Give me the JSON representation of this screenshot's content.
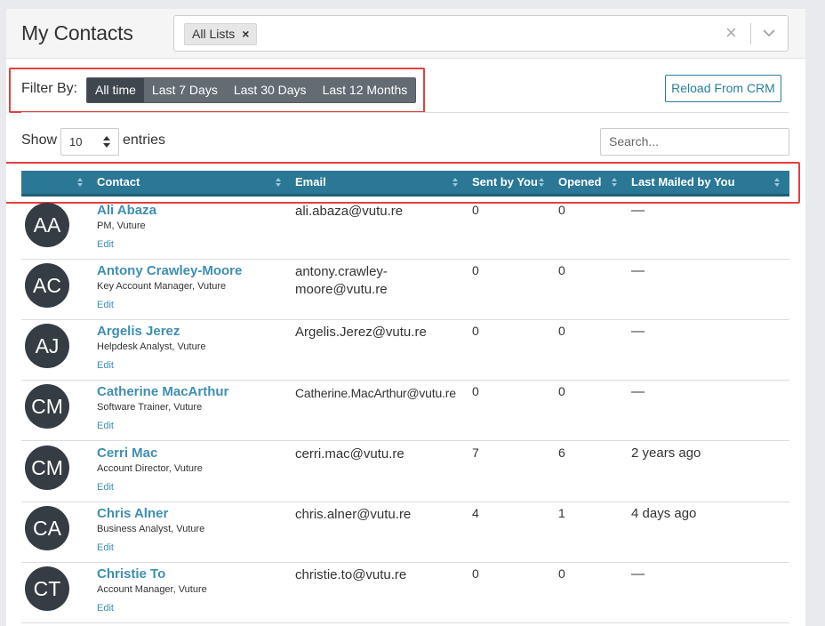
{
  "header": {
    "title": "My Contacts",
    "list_chip": "All Lists",
    "chip_remove": "×",
    "clear": "×"
  },
  "filter": {
    "label": "Filter By:",
    "options": [
      "All time",
      "Last 7 Days",
      "Last 30 Days",
      "Last 12 Months"
    ],
    "active_index": 0
  },
  "reload_label": "Reload From CRM",
  "table_controls": {
    "show_label": "Show",
    "entries_value": "10",
    "entries_label": "entries",
    "search_placeholder": "Search..."
  },
  "columns": [
    "Contact",
    "Email",
    "Sent by You",
    "Opened",
    "Last Mailed by You"
  ],
  "edit_label": "Edit",
  "contacts": [
    {
      "initials": "AA",
      "name": "Ali Abaza",
      "role": "PM, Vuture",
      "email": "ali.abaza@vutu.re",
      "sent": "0",
      "opened": "0",
      "last": "—"
    },
    {
      "initials": "AC",
      "name": "Antony Crawley-Moore",
      "role": "Key Account Manager, Vuture",
      "email": "antony.crawley-moore@vutu.re",
      "sent": "0",
      "opened": "0",
      "last": "—"
    },
    {
      "initials": "AJ",
      "name": "Argelis Jerez",
      "role": "Helpdesk Analyst, Vuture",
      "email": "Argelis.Jerez@vutu.re",
      "sent": "0",
      "opened": "0",
      "last": "—"
    },
    {
      "initials": "CM",
      "name": "Catherine MacArthur",
      "role": "Software Trainer, Vuture",
      "email": "Catherine.MacArthur@vutu.re",
      "sent": "0",
      "opened": "0",
      "last": "—"
    },
    {
      "initials": "CM",
      "name": "Cerri Mac",
      "role": "Account Director, Vuture",
      "email": "cerri.mac@vutu.re",
      "sent": "7",
      "opened": "6",
      "last": "2 years ago"
    },
    {
      "initials": "CA",
      "name": "Chris Alner",
      "role": "Business Analyst, Vuture",
      "email": "chris.alner@vutu.re",
      "sent": "4",
      "opened": "1",
      "last": "4 days ago"
    },
    {
      "initials": "CT",
      "name": "Christie To",
      "role": "Account Manager, Vuture",
      "email": "christie.to@vutu.re",
      "sent": "0",
      "opened": "0",
      "last": "—"
    }
  ]
}
